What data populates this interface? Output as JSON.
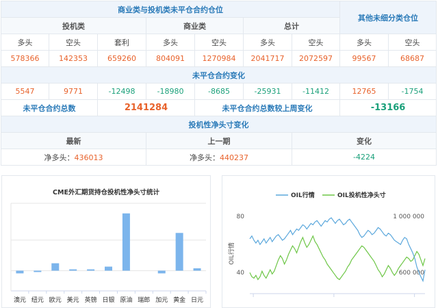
{
  "cot": {
    "title_main": "商业类与投机类未平仓合约仓位",
    "title_other": "其他未细分类仓位",
    "group_spec": "投机类",
    "group_comm": "商业类",
    "group_total": "总计",
    "col_long": "多头",
    "col_short": "空头",
    "col_spread": "套利",
    "values": [
      "578366",
      "142353",
      "659260",
      "804091",
      "1270984",
      "2041717",
      "2072597",
      "99567",
      "68687"
    ],
    "change_title": "未平仓合约变化",
    "changes": [
      "5547",
      "9771",
      "-12498",
      "-18980",
      "-8685",
      "-25931",
      "-11412",
      "12765",
      "-1754"
    ],
    "total_label": "未平仓合约总数",
    "total_value": "2141284",
    "weekly_label": "未平仓合约总数较上周变化",
    "weekly_value": "-13166",
    "net_title": "投机性净头寸变化",
    "net_latest_label": "最新",
    "net_prev_label": "上一期",
    "net_change_label": "变化",
    "net_latest_prefix": "净多头：",
    "net_latest_value": "436013",
    "net_prev_prefix": "净多头：",
    "net_prev_value": "440237",
    "net_change_value": "-4224"
  },
  "colors": {
    "accent_blue": "#2a7ab8",
    "positive_orange": "#e8622b",
    "negative_green": "#1aa07a",
    "bar_blue": "#7cb5ec",
    "oil_line": "#5aa7dc",
    "spec_line": "#6dc646"
  },
  "chart_data": [
    {
      "type": "bar",
      "title": "CME外汇期货持仓投机性净头寸统计",
      "categories": [
        "澳元",
        "纽元",
        "欧元",
        "美元",
        "英镑",
        "日银",
        "原油",
        "瑞郎",
        "加元",
        "黄金",
        "日元"
      ],
      "values": [
        -8000,
        -4000,
        22000,
        4000,
        4000,
        12000,
        170000,
        0,
        -8000,
        112000,
        7000
      ],
      "ylim": [
        -60000,
        200000
      ],
      "grid": true,
      "legend": "none"
    },
    {
      "type": "line",
      "ylabel": "OIL行情",
      "series": [
        {
          "name": "OIL行情",
          "axis": "left",
          "y": [
            64,
            66,
            63,
            61,
            63,
            60,
            62,
            64,
            61,
            63,
            65,
            62,
            64,
            66,
            67,
            65,
            63,
            64,
            66,
            68,
            70,
            67,
            69,
            71,
            70,
            72,
            74,
            73,
            71,
            73,
            75,
            74,
            76,
            77,
            75,
            73,
            75,
            77,
            76,
            78,
            79,
            77,
            75,
            77,
            78,
            76,
            74,
            75,
            77,
            78,
            76,
            74,
            72,
            70,
            67,
            65,
            66,
            68,
            70,
            69,
            67,
            68,
            70,
            72,
            71,
            69,
            67,
            66,
            68,
            67,
            65,
            63,
            62,
            61,
            60,
            63,
            65,
            64,
            60,
            57,
            54,
            50,
            44,
            40,
            37,
            34,
            42
          ]
        },
        {
          "name": "OIL投机性净头寸",
          "axis": "right",
          "y": [
            600000,
            570000,
            560000,
            580000,
            550000,
            570000,
            610000,
            580000,
            560000,
            590000,
            620000,
            590000,
            610000,
            650000,
            690000,
            720000,
            700000,
            660000,
            690000,
            730000,
            760000,
            790000,
            770000,
            740000,
            780000,
            820000,
            850000,
            810000,
            780000,
            800000,
            830000,
            860000,
            820000,
            800000,
            770000,
            740000,
            710000,
            690000,
            660000,
            640000,
            620000,
            600000,
            580000,
            560000,
            550000,
            570000,
            590000,
            610000,
            640000,
            660000,
            690000,
            710000,
            730000,
            750000,
            770000,
            790000,
            780000,
            760000,
            740000,
            720000,
            700000,
            680000,
            650000,
            620000,
            600000,
            570000,
            590000,
            620000,
            650000,
            630000,
            600000,
            580000,
            600000,
            630000,
            650000,
            670000,
            690000,
            710000,
            700000,
            680000,
            690000,
            720000,
            750000,
            730000,
            690000,
            650000,
            700000
          ]
        }
      ],
      "y_left_lim": [
        25,
        82
      ],
      "y_left_ticks": [
        "80",
        "40"
      ],
      "y_right_lim": [
        450000,
        1020000
      ],
      "y_right_ticks": [
        "1 000 000",
        "600 000"
      ],
      "grid": false,
      "legend": "top"
    }
  ]
}
